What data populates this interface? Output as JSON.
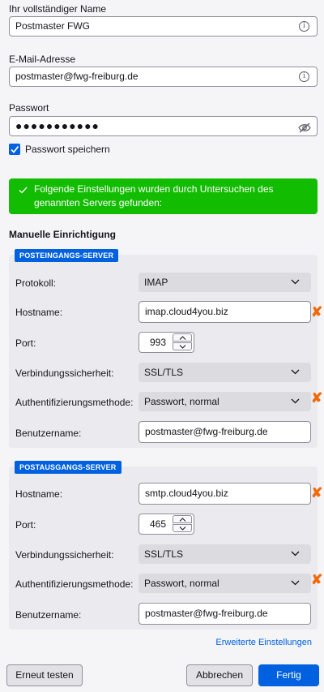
{
  "account": {
    "name_label": "Ihr vollständiger Name",
    "name_value": "Postmaster FWG",
    "email_label": "E-Mail-Adresse",
    "email_value": "postmaster@fwg-freiburg.de",
    "password_label": "Passwort",
    "password_value": "●●●●●●●●●●●",
    "remember_label": "Passwort speichern",
    "remember_checked": true
  },
  "banner": {
    "line1": "Folgende Einstellungen wurden durch Untersuchen des",
    "line2": "genannten Servers gefunden:",
    "color": "#12bc00"
  },
  "manual": {
    "title": "Manuelle Einrichtigung",
    "incoming": {
      "tag": "POSTEINGANGS-SERVER",
      "protocol_label": "Protokoll:",
      "protocol_value": "IMAP",
      "hostname_label": "Hostname:",
      "hostname_value": "imap.cloud4you.biz",
      "port_label": "Port:",
      "port_value": "993",
      "security_label": "Verbindungssicherheit:",
      "security_value": "SSL/TLS",
      "auth_label": "Authentifizierungsmethode:",
      "auth_value": "Passwort, normal",
      "username_label": "Benutzername:",
      "username_value": "postmaster@fwg-freiburg.de"
    },
    "outgoing": {
      "tag": "POSTAUSGANGS-SERVER",
      "hostname_label": "Hostname:",
      "hostname_value": "smtp.cloud4you.biz",
      "port_label": "Port:",
      "port_value": "465",
      "security_label": "Verbindungssicherheit:",
      "security_value": "SSL/TLS",
      "auth_label": "Authentifizierungsmethode:",
      "auth_value": "Passwort, normal",
      "username_label": "Benutzername:",
      "username_value": "postmaster@fwg-freiburg.de"
    },
    "marker_symbol": "✘",
    "marker_color": "#f06a0a"
  },
  "advanced_link": "Erweiterte Einstellungen",
  "buttons": {
    "retest": "Erneut testen",
    "cancel": "Abbrechen",
    "done": "Fertig"
  },
  "icons": {
    "info": "info-icon",
    "eye": "eye-slash-icon",
    "check": "checkmark-icon",
    "chevron": "chevron-down-icon"
  }
}
